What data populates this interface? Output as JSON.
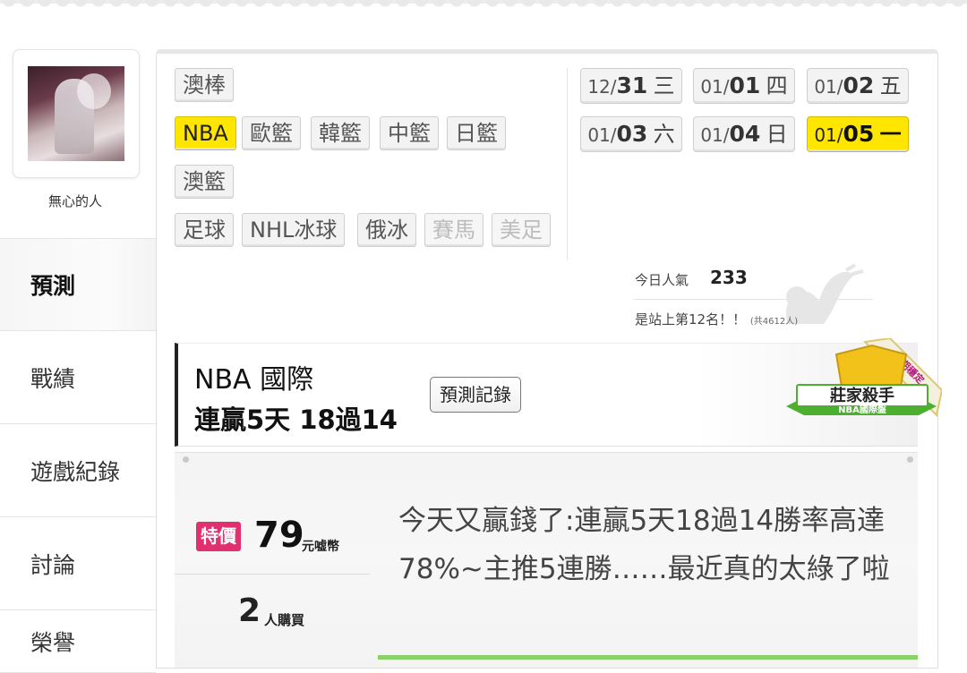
{
  "user": {
    "name": "無心的人"
  },
  "sidebar": {
    "items": [
      {
        "label": "預測",
        "active": true
      },
      {
        "label": "戰績",
        "active": false
      },
      {
        "label": "遊戲紀錄",
        "active": false
      },
      {
        "label": "討論",
        "active": false
      },
      {
        "label": "榮譽",
        "active": false
      }
    ]
  },
  "sports": {
    "row1": [
      "澳棒"
    ],
    "row2": [
      "NBA",
      "歐籃",
      "韓籃",
      "中籃",
      "日籃"
    ],
    "row3": [
      "澳籃"
    ],
    "row4": [
      "足球",
      "NHL冰球",
      "俄冰",
      "賽馬",
      "美足"
    ],
    "selected": "NBA",
    "disabled": [
      "賽馬",
      "美足"
    ]
  },
  "dates": [
    {
      "prefix": "12/",
      "day": "31",
      "weekday": "三",
      "selected": false
    },
    {
      "prefix": "01/",
      "day": "01",
      "weekday": "四",
      "selected": false
    },
    {
      "prefix": "01/",
      "day": "02",
      "weekday": "五",
      "selected": false
    },
    {
      "prefix": "01/",
      "day": "03",
      "weekday": "六",
      "selected": false
    },
    {
      "prefix": "01/",
      "day": "04",
      "weekday": "日",
      "selected": false
    },
    {
      "prefix": "01/",
      "day": "05",
      "weekday": "一",
      "selected": true
    }
  ],
  "popularity": {
    "label": "今日人氣",
    "value": "233",
    "rank_text": "是站上第12名！！",
    "total_text": "(共4612人)"
  },
  "banner": {
    "title": "NBA 國際",
    "streak": "連贏5天 18過14",
    "record_button": "預測記錄",
    "badge_main": "莊家殺手",
    "badge_sub": "NBA國際盤",
    "badge_ribbon": "長期穩定"
  },
  "offer": {
    "special_label": "特價",
    "price": "79",
    "price_unit": "元嘘幣",
    "buyers": "2",
    "buyers_unit": "人購買",
    "description": "今天又贏錢了:連贏5天18過14勝率高達78%~主推5連勝……最近真的太綠了啦"
  },
  "colors": {
    "selected_yellow": "#ffe600",
    "special_pink": "#e0306f",
    "badge_green": "#4caf2f",
    "badge_gold": "#f2c21b"
  }
}
